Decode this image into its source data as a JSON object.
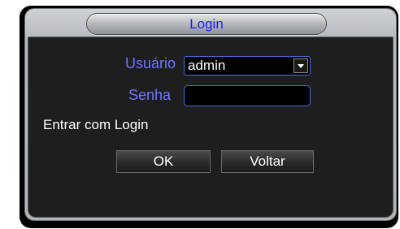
{
  "dialog": {
    "title": "Login"
  },
  "form": {
    "user_label": "Usuário",
    "user_value": "admin",
    "password_label": "Senha",
    "password_value": "",
    "login_mode_text": "Entrar com Login"
  },
  "buttons": {
    "ok_label": "OK",
    "back_label": "Voltar"
  },
  "colors": {
    "title_text": "#1c1cff",
    "label_text": "#6f75ff",
    "field_border": "#4c6ed8",
    "content_bg": "#1e1e1e"
  }
}
